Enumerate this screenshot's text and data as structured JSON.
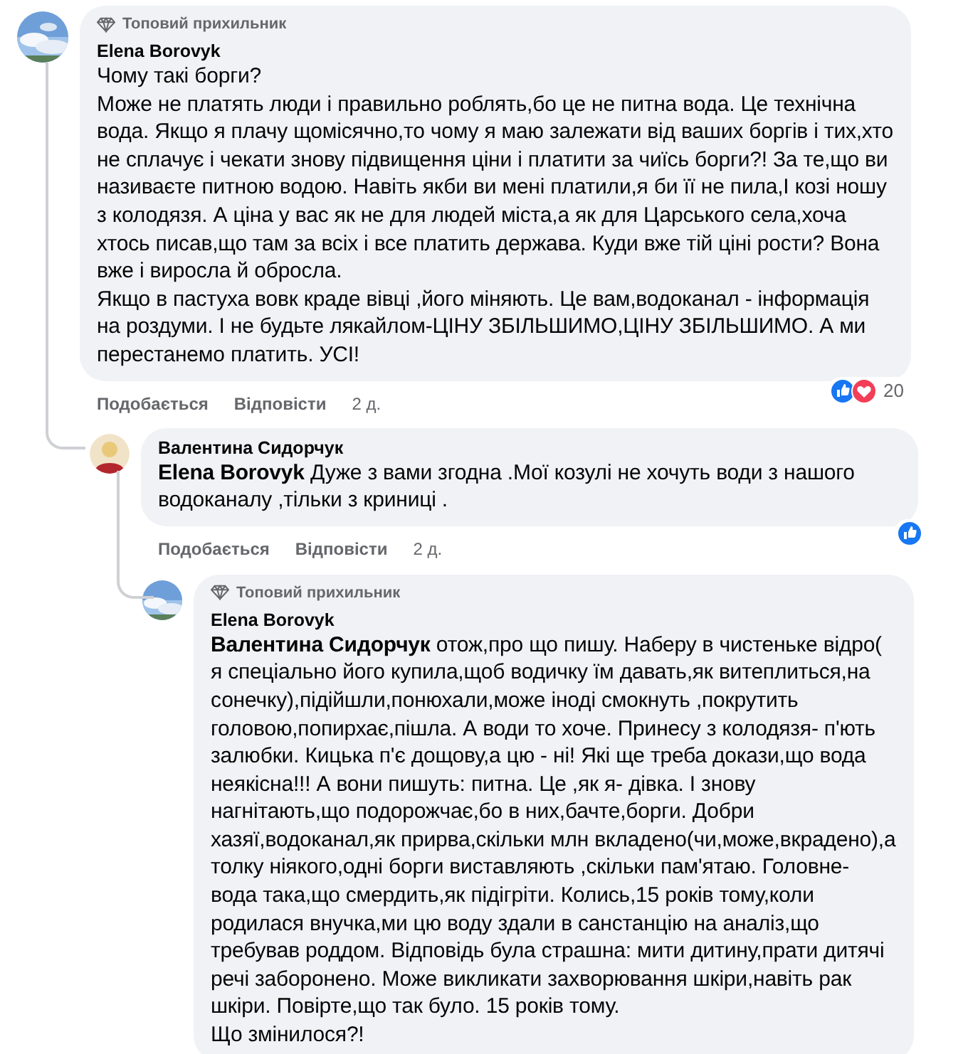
{
  "comments": [
    {
      "badge": "Топовий прихильник",
      "author": "Elena Borovyk",
      "avatar": {
        "kind": "picture"
      },
      "text": "Чому такі борги?\nМоже не платять люди і правильно роблять,бо це не питна вода. Це технічна вода. Якщо я плачу щомісячно,то чому я маю залежати від ваших боргів і тих,хто не сплачує і чекати знову підвищення ціни і платити за чиїсь борги?! За те,що ви називаєте питною водою. Навіть якби ви мені платили,я би її не пила,І козі ношу з колодязя. А ціна у вас як не для людей міста,а як для Царського села,хоча хтось писав,що там за всіх і все платить держава. Куди вже тій ціні рости? Вона вже і виросла й обросла.\nЯкщо в пастуха вовк краде вівці ,його міняють. Це вам,водоканал - інформація на роздуми. І не будьте лякайлом-ЦІНУ ЗБІЛЬШИМО,ЦІНУ ЗБІЛЬШИМО. А ми перестанемо платить. УСІ!",
      "reactions": {
        "like": true,
        "love": true,
        "count": "20"
      },
      "actions": [
        "Подобається",
        "Відповісти"
      ],
      "time": "2 д.",
      "replies": [
        {
          "author": "Валентина Сидорчук",
          "avatar": {
            "kind": "person"
          },
          "text": "**Elena Borovyk** Дуже з вами згодна .Мої козулі не хочуть води з нашого водоканалу ,тільки з криниці .",
          "reactions": {
            "like": true,
            "love": false
          },
          "actions": [
            "Подобається",
            "Відповісти"
          ],
          "time": "2 д.",
          "replies": [
            {
              "badge": "Топовий прихильник",
              "author": "Elena Borovyk",
              "avatar": {
                "kind": "picture"
              },
              "text": "**Валентина Сидорчук** отож,про що пишу. Наберу в чистеньке відро( я спеціально його купила,щоб водичку їм давать,як витеплиться,на сонечку),підійшли,понюхали,може іноді смокнуть ,покрутить головою,попирхає,пішла. А води то хоче. Принесу з колодязя- п'ють залюбки. Кицька п'є дощову,а цю - ні! Які ще треба докази,що вода неякісна!!! А вони пишуть: питна. Це ,як я- дівка. І знову нагнітають,що подорожчає,бо в них,бачте,борги. Добри хазяї,водоканал,як прирва,скільки млн вкладено(чи,може,вкрадено),а толку ніякого,одні борги виставляють ,скільки пам'ятаю. Головне- вода така,що смердить,як підігріти. Колись,15 років тому,коли родилася внучка,ми цю воду здали в санстанцію на аналіз,що требував роддом. Відповідь була страшна: мити дитину,прати дитячі речі заборонено. Може викликати захворювання шкіри,навіть рак шкіри. Повірте,що так було. 15 років тому.\nЩо змінилося?!"
            }
          ]
        }
      ]
    }
  ]
}
